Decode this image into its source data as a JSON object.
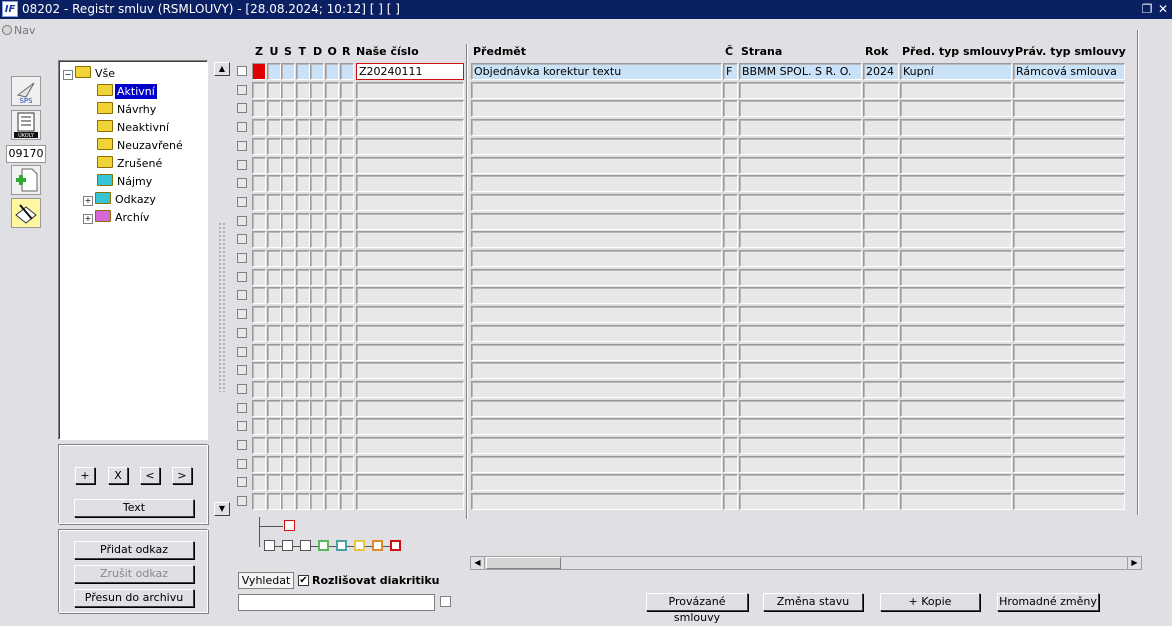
{
  "window": {
    "title": "08202 - Registr smluv (RSMLOUVY) - [28.08.2024; 10:12] [ ] [ ]",
    "logo": "IF"
  },
  "toolbar": {
    "nav_label": "Nav",
    "sps_label": "SPS",
    "ukoly_label": "ÚKOLY",
    "code": "09170"
  },
  "tree": [
    {
      "label": "Vše",
      "level": 0,
      "expander": "−",
      "color": "#f2d335",
      "selected": false
    },
    {
      "label": "Aktivní",
      "level": 1,
      "expander": "",
      "color": "#f2d335",
      "selected": true
    },
    {
      "label": "Návrhy",
      "level": 1,
      "expander": "",
      "color": "#f2d335",
      "selected": false
    },
    {
      "label": "Neaktivní",
      "level": 1,
      "expander": "",
      "color": "#f2d335",
      "selected": false
    },
    {
      "label": "Neuzavřené",
      "level": 1,
      "expander": "",
      "color": "#f2d335",
      "selected": false
    },
    {
      "label": "Zrušené",
      "level": 1,
      "expander": "",
      "color": "#f2d335",
      "selected": false
    },
    {
      "label": "Nájmy",
      "level": 1,
      "expander": "",
      "color": "#36c3d6",
      "selected": false
    },
    {
      "label": "Odkazy",
      "level": 1,
      "expander": "+",
      "color": "#36c3d6",
      "selected": false
    },
    {
      "label": "Archív",
      "level": 1,
      "expander": "+",
      "color": "#d56ad6",
      "selected": false
    }
  ],
  "tree_controls": {
    "add": "+",
    "remove": "X",
    "prev": "<",
    "next": ">",
    "text": "Text"
  },
  "links_panel": {
    "add_link": "Přidat odkaz",
    "cancel_link": "Zrušit odkaz",
    "move_archive": "Přesun do archivu"
  },
  "search": {
    "button": "Vyhledat",
    "diacritics_label": "Rozlišovat diakritiku",
    "diacritics_checked": true,
    "value": ""
  },
  "grid": {
    "flag_headers": [
      "Z",
      "U",
      "S",
      "T",
      "D",
      "O",
      "R"
    ],
    "columns": {
      "nase_cislo": "Naše číslo",
      "predmet": "Předmět",
      "c": "Č",
      "strana": "Strana",
      "rok": "Rok",
      "pred_typ": "Před. typ smlouvy",
      "prav_typ": "Práv. typ smlouvy"
    },
    "rows": [
      {
        "nase_cislo": "Z20240111",
        "predmet": "Objednávka korektur textu",
        "c": "F",
        "strana": "BBMM SPOL. S R. O.",
        "rok": "2024",
        "pred_typ": "Kupní",
        "prav_typ": "Rámcová smlouva"
      }
    ],
    "empty_rows": 23,
    "status_color": "#e00000"
  },
  "legend_colors": [
    "#ffffff",
    "#ffffff",
    "#ffffff",
    "#5cb85c",
    "#4aa3a0",
    "#e8c547",
    "#e08a2a",
    "#d01010"
  ],
  "bottom_buttons": {
    "linked": "Provázané smlouvy",
    "change_state": "Změna stavu",
    "copy": "+ Kopie",
    "bulk": "Hromadné změny"
  }
}
